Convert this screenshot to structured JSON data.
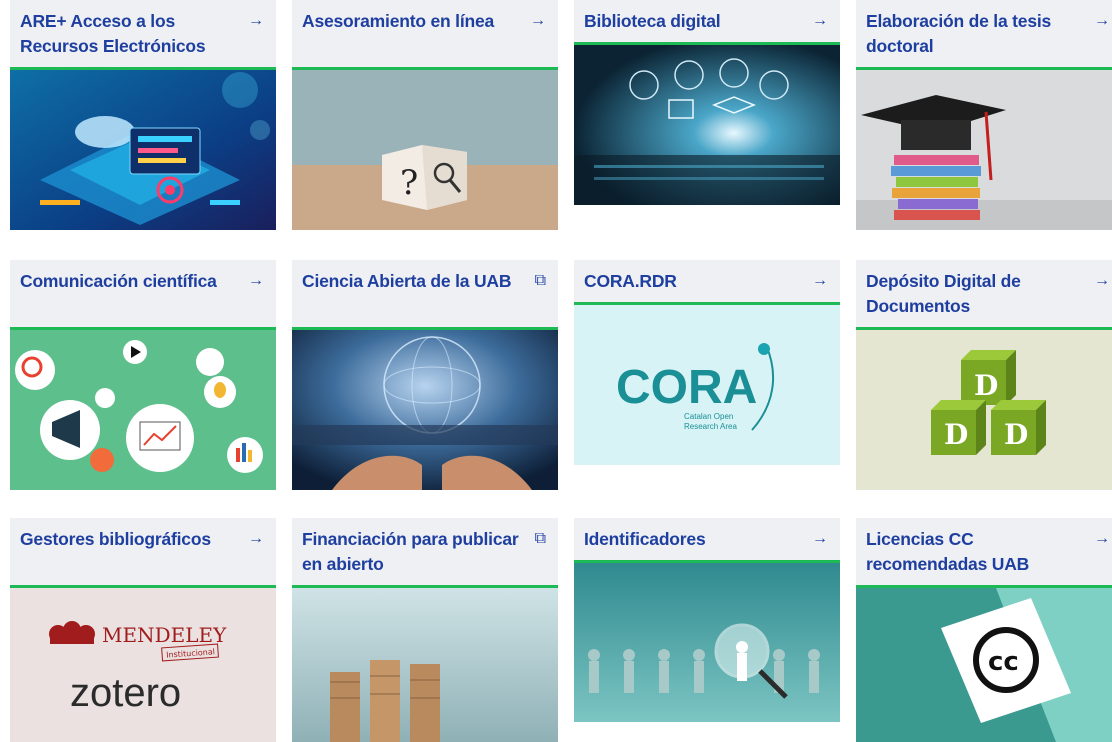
{
  "cards": [
    {
      "title": "ARE+ Acceso a los Recursos Electrónicos",
      "icon": "arrow-right-icon",
      "arrow": "→"
    },
    {
      "title": "Asesoramiento en línea",
      "icon": "arrow-right-icon",
      "arrow": "→"
    },
    {
      "title": "Biblioteca digital",
      "icon": "arrow-right-icon",
      "arrow": "→"
    },
    {
      "title": "Elaboración de la tesis doctoral",
      "icon": "arrow-right-icon",
      "arrow": "→"
    },
    {
      "title": "Comunicación científica",
      "icon": "arrow-right-icon",
      "arrow": "→"
    },
    {
      "title": "Ciencia Abierta de la UAB",
      "icon": "external-link-icon",
      "arrow": "⧉"
    },
    {
      "title": "CORA.RDR",
      "icon": "arrow-right-icon",
      "arrow": "→"
    },
    {
      "title": "Depósito Digital de Documentos",
      "icon": "arrow-right-icon",
      "arrow": "→"
    },
    {
      "title": "Gestores bibliográficos",
      "icon": "arrow-right-icon",
      "arrow": "→"
    },
    {
      "title": "Financiación para publicar en abierto",
      "icon": "external-link-icon",
      "arrow": "⧉"
    },
    {
      "title": "Identificadores",
      "icon": "arrow-right-icon",
      "arrow": "→"
    },
    {
      "title": "Licencias CC recomendadas UAB",
      "icon": "arrow-right-icon",
      "arrow": "→"
    }
  ],
  "images": {
    "question": "?",
    "cora_logo": "CORA",
    "cora_sub1": "Catalan Open",
    "cora_sub2": "Research Area",
    "dep_letter": "D",
    "mendeley": "MENDELEY",
    "mendeley_stamp": "Institucional",
    "zotero": "zotero",
    "cc": "cc"
  },
  "colors": {
    "title": "#1f3fa0",
    "accent": "#1db954",
    "header_bg": "#eef0f3"
  }
}
